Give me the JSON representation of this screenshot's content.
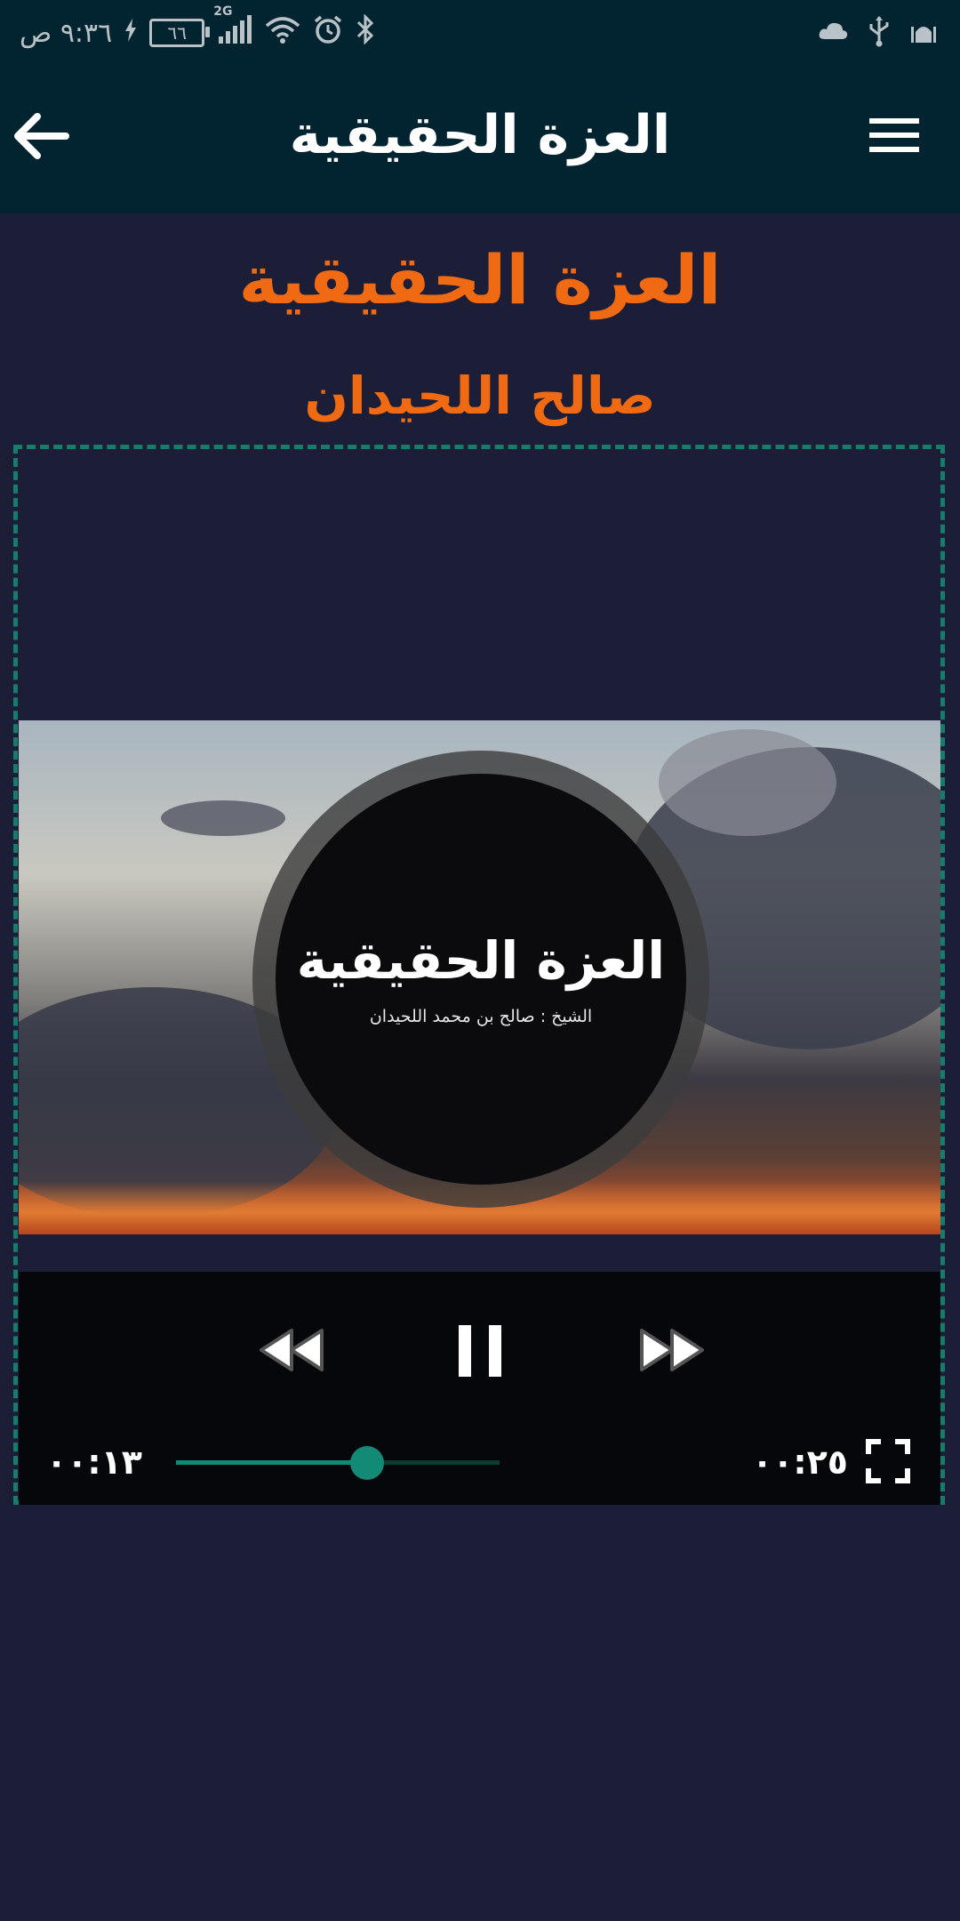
{
  "status_bar": {
    "time": "٩:٣٦ ص",
    "battery": "٦٦",
    "network": "2G"
  },
  "app_bar": {
    "title": "العزة الحقيقية"
  },
  "content": {
    "title": "العزة الحقيقية",
    "speaker": "صالح اللحيدان"
  },
  "video": {
    "overlay_title": "العزة الحقيقية",
    "overlay_subtitle": "الشيخ : صالح بن محمد اللحيدان"
  },
  "player": {
    "elapsed": "٠٠:١٣",
    "duration": "٠٠:٢٥",
    "progress": 0.59
  },
  "colors": {
    "accent_orange": "#f06a13",
    "accent_teal": "#138a76",
    "bar_bg": "#022330",
    "page_bg": "#1c1e38"
  }
}
